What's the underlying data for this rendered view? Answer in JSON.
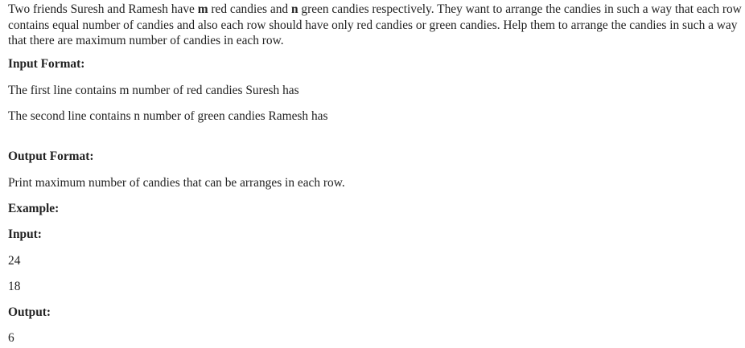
{
  "intro": {
    "part1": "Two friends Suresh and Ramesh have ",
    "m": "m",
    "part2": " red candies and ",
    "n": "n",
    "part3": " green candies respectively. They want to arrange the candies in such a way that each row contains equal number of candies and also each row should have only red candies or green candies. Help them to arrange the candies in such a way that there are maximum number of candies in each row."
  },
  "input_format": {
    "heading": "Input Format:",
    "line1": "The first line contains m number of red candies Suresh has",
    "line2": "The second line contains n number of green candies Ramesh has"
  },
  "output_format": {
    "heading": "Output Format:",
    "line1": "Print maximum number of candies that can be arranges in each row."
  },
  "example": {
    "heading": "Example:",
    "input_heading": "Input:",
    "input_values": [
      "24",
      "18"
    ],
    "output_heading": "Output:",
    "output_value": "6"
  }
}
